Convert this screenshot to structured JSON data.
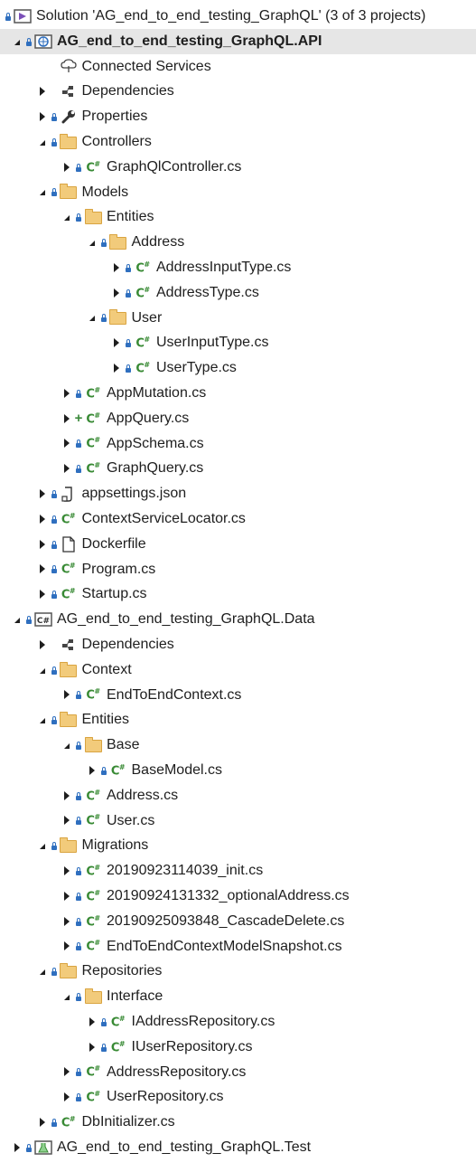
{
  "solution_explorer": {
    "items": [
      {
        "label": "Solution 'AG_end_to_end_testing_GraphQL' (3 of 3 projects)",
        "level": -1,
        "expander": "none",
        "state": "lock",
        "icon": "solution-icon"
      },
      {
        "label": "AG_end_to_end_testing_GraphQL.API",
        "level": 0,
        "expander": "expanded",
        "state": "lock",
        "icon": "web-project-icon",
        "selected": true
      },
      {
        "label": "Connected Services",
        "level": 1,
        "expander": "none",
        "state": "none",
        "icon": "connected-services-icon"
      },
      {
        "label": "Dependencies",
        "level": 1,
        "expander": "collapsed",
        "state": "none",
        "icon": "dependencies-icon"
      },
      {
        "label": "Properties",
        "level": 1,
        "expander": "collapsed",
        "state": "lock",
        "icon": "wrench-icon"
      },
      {
        "label": "Controllers",
        "level": 1,
        "expander": "expanded",
        "state": "lock",
        "icon": "folder-icon"
      },
      {
        "label": "GraphQlController.cs",
        "level": 2,
        "expander": "collapsed",
        "state": "lock",
        "icon": "csharp-file-icon"
      },
      {
        "label": "Models",
        "level": 1,
        "expander": "expanded",
        "state": "lock",
        "icon": "folder-icon"
      },
      {
        "label": "Entities",
        "level": 2,
        "expander": "expanded",
        "state": "lock",
        "icon": "folder-icon"
      },
      {
        "label": "Address",
        "level": 3,
        "expander": "expanded",
        "state": "lock",
        "icon": "folder-icon"
      },
      {
        "label": "AddressInputType.cs",
        "level": 4,
        "expander": "collapsed",
        "state": "lock",
        "icon": "csharp-file-icon"
      },
      {
        "label": "AddressType.cs",
        "level": 4,
        "expander": "collapsed",
        "state": "lock",
        "icon": "csharp-file-icon"
      },
      {
        "label": "User",
        "level": 3,
        "expander": "expanded",
        "state": "lock",
        "icon": "folder-icon"
      },
      {
        "label": "UserInputType.cs",
        "level": 4,
        "expander": "collapsed",
        "state": "lock",
        "icon": "csharp-file-icon"
      },
      {
        "label": "UserType.cs",
        "level": 4,
        "expander": "collapsed",
        "state": "lock",
        "icon": "csharp-file-icon"
      },
      {
        "label": "AppMutation.cs",
        "level": 2,
        "expander": "collapsed",
        "state": "lock",
        "icon": "csharp-file-icon"
      },
      {
        "label": "AppQuery.cs",
        "level": 2,
        "expander": "collapsed",
        "state": "plus",
        "icon": "csharp-file-icon"
      },
      {
        "label": "AppSchema.cs",
        "level": 2,
        "expander": "collapsed",
        "state": "lock",
        "icon": "csharp-file-icon"
      },
      {
        "label": "GraphQuery.cs",
        "level": 2,
        "expander": "collapsed",
        "state": "lock",
        "icon": "csharp-file-icon"
      },
      {
        "label": "appsettings.json",
        "level": 1,
        "expander": "collapsed",
        "state": "lock",
        "icon": "json-file-icon"
      },
      {
        "label": "ContextServiceLocator.cs",
        "level": 1,
        "expander": "collapsed",
        "state": "lock",
        "icon": "csharp-file-icon"
      },
      {
        "label": "Dockerfile",
        "level": 1,
        "expander": "collapsed",
        "state": "lock",
        "icon": "file-icon"
      },
      {
        "label": "Program.cs",
        "level": 1,
        "expander": "collapsed",
        "state": "lock",
        "icon": "csharp-file-icon"
      },
      {
        "label": "Startup.cs",
        "level": 1,
        "expander": "collapsed",
        "state": "lock",
        "icon": "csharp-file-icon"
      },
      {
        "label": "AG_end_to_end_testing_GraphQL.Data",
        "level": 0,
        "expander": "expanded",
        "state": "lock",
        "icon": "csharp-project-icon"
      },
      {
        "label": "Dependencies",
        "level": 1,
        "expander": "collapsed",
        "state": "none",
        "icon": "dependencies-icon"
      },
      {
        "label": "Context",
        "level": 1,
        "expander": "expanded",
        "state": "lock",
        "icon": "folder-icon"
      },
      {
        "label": "EndToEndContext.cs",
        "level": 2,
        "expander": "collapsed",
        "state": "lock",
        "icon": "csharp-file-icon"
      },
      {
        "label": "Entities",
        "level": 1,
        "expander": "expanded",
        "state": "lock",
        "icon": "folder-icon"
      },
      {
        "label": "Base",
        "level": 2,
        "expander": "expanded",
        "state": "lock",
        "icon": "folder-icon"
      },
      {
        "label": "BaseModel.cs",
        "level": 3,
        "expander": "collapsed",
        "state": "lock",
        "icon": "csharp-file-icon"
      },
      {
        "label": "Address.cs",
        "level": 2,
        "expander": "collapsed",
        "state": "lock",
        "icon": "csharp-file-icon"
      },
      {
        "label": "User.cs",
        "level": 2,
        "expander": "collapsed",
        "state": "lock",
        "icon": "csharp-file-icon"
      },
      {
        "label": "Migrations",
        "level": 1,
        "expander": "expanded",
        "state": "lock",
        "icon": "folder-icon"
      },
      {
        "label": "20190923114039_init.cs",
        "level": 2,
        "expander": "collapsed",
        "state": "lock",
        "icon": "csharp-file-icon"
      },
      {
        "label": "20190924131332_optionalAddress.cs",
        "level": 2,
        "expander": "collapsed",
        "state": "lock",
        "icon": "csharp-file-icon"
      },
      {
        "label": "20190925093848_CascadeDelete.cs",
        "level": 2,
        "expander": "collapsed",
        "state": "lock",
        "icon": "csharp-file-icon"
      },
      {
        "label": "EndToEndContextModelSnapshot.cs",
        "level": 2,
        "expander": "collapsed",
        "state": "lock",
        "icon": "csharp-file-icon"
      },
      {
        "label": "Repositories",
        "level": 1,
        "expander": "expanded",
        "state": "lock",
        "icon": "folder-icon"
      },
      {
        "label": "Interface",
        "level": 2,
        "expander": "expanded",
        "state": "lock",
        "icon": "folder-icon"
      },
      {
        "label": "IAddressRepository.cs",
        "level": 3,
        "expander": "collapsed",
        "state": "lock",
        "icon": "csharp-file-icon"
      },
      {
        "label": "IUserRepository.cs",
        "level": 3,
        "expander": "collapsed",
        "state": "lock",
        "icon": "csharp-file-icon"
      },
      {
        "label": "AddressRepository.cs",
        "level": 2,
        "expander": "collapsed",
        "state": "lock",
        "icon": "csharp-file-icon"
      },
      {
        "label": "UserRepository.cs",
        "level": 2,
        "expander": "collapsed",
        "state": "lock",
        "icon": "csharp-file-icon"
      },
      {
        "label": "DbInitializer.cs",
        "level": 1,
        "expander": "collapsed",
        "state": "lock",
        "icon": "csharp-file-icon"
      },
      {
        "label": "AG_end_to_end_testing_GraphQL.Test",
        "level": 0,
        "expander": "collapsed",
        "state": "lock",
        "icon": "test-project-icon"
      }
    ]
  },
  "colors": {
    "selection": "#e6e6e6",
    "lock": "#2f6fbf",
    "csharp": "#388a34",
    "folder": "#f2cb7b"
  }
}
